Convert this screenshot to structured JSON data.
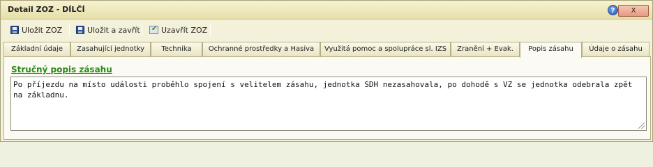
{
  "window": {
    "title": "Detail ZOZ - DÍLČÍ",
    "help_glyph": "?",
    "close_label": "X"
  },
  "toolbar": {
    "save_label": "Uložit ZOZ",
    "save_close_label": "Uložit a zavřít",
    "close_zoz_label": "Uzavřít ZOZ"
  },
  "tabs": [
    {
      "label": "Základní údaje"
    },
    {
      "label": "Zasahující jednotky"
    },
    {
      "label": "Technika"
    },
    {
      "label": "Ochranné prostředky a Hasiva"
    },
    {
      "label": "Využitá pomoc a spolupráce sl. IZS"
    },
    {
      "label": "Zranění + Evak."
    },
    {
      "label": "Popis zásahu"
    },
    {
      "label": "Údaje o zásahu"
    }
  ],
  "active_tab": "Popis zásahu",
  "panel": {
    "section_title": "Stručný popis zásahu",
    "description": "Po příjezdu na místo události proběhlo spojení s velitelem zásahu, jednotka SDH nezasahovala, po dohodě s VZ se jednotka odebrala zpět na základnu."
  },
  "colors": {
    "section_title": "#2a8a17",
    "close_button": "#e59a80"
  }
}
